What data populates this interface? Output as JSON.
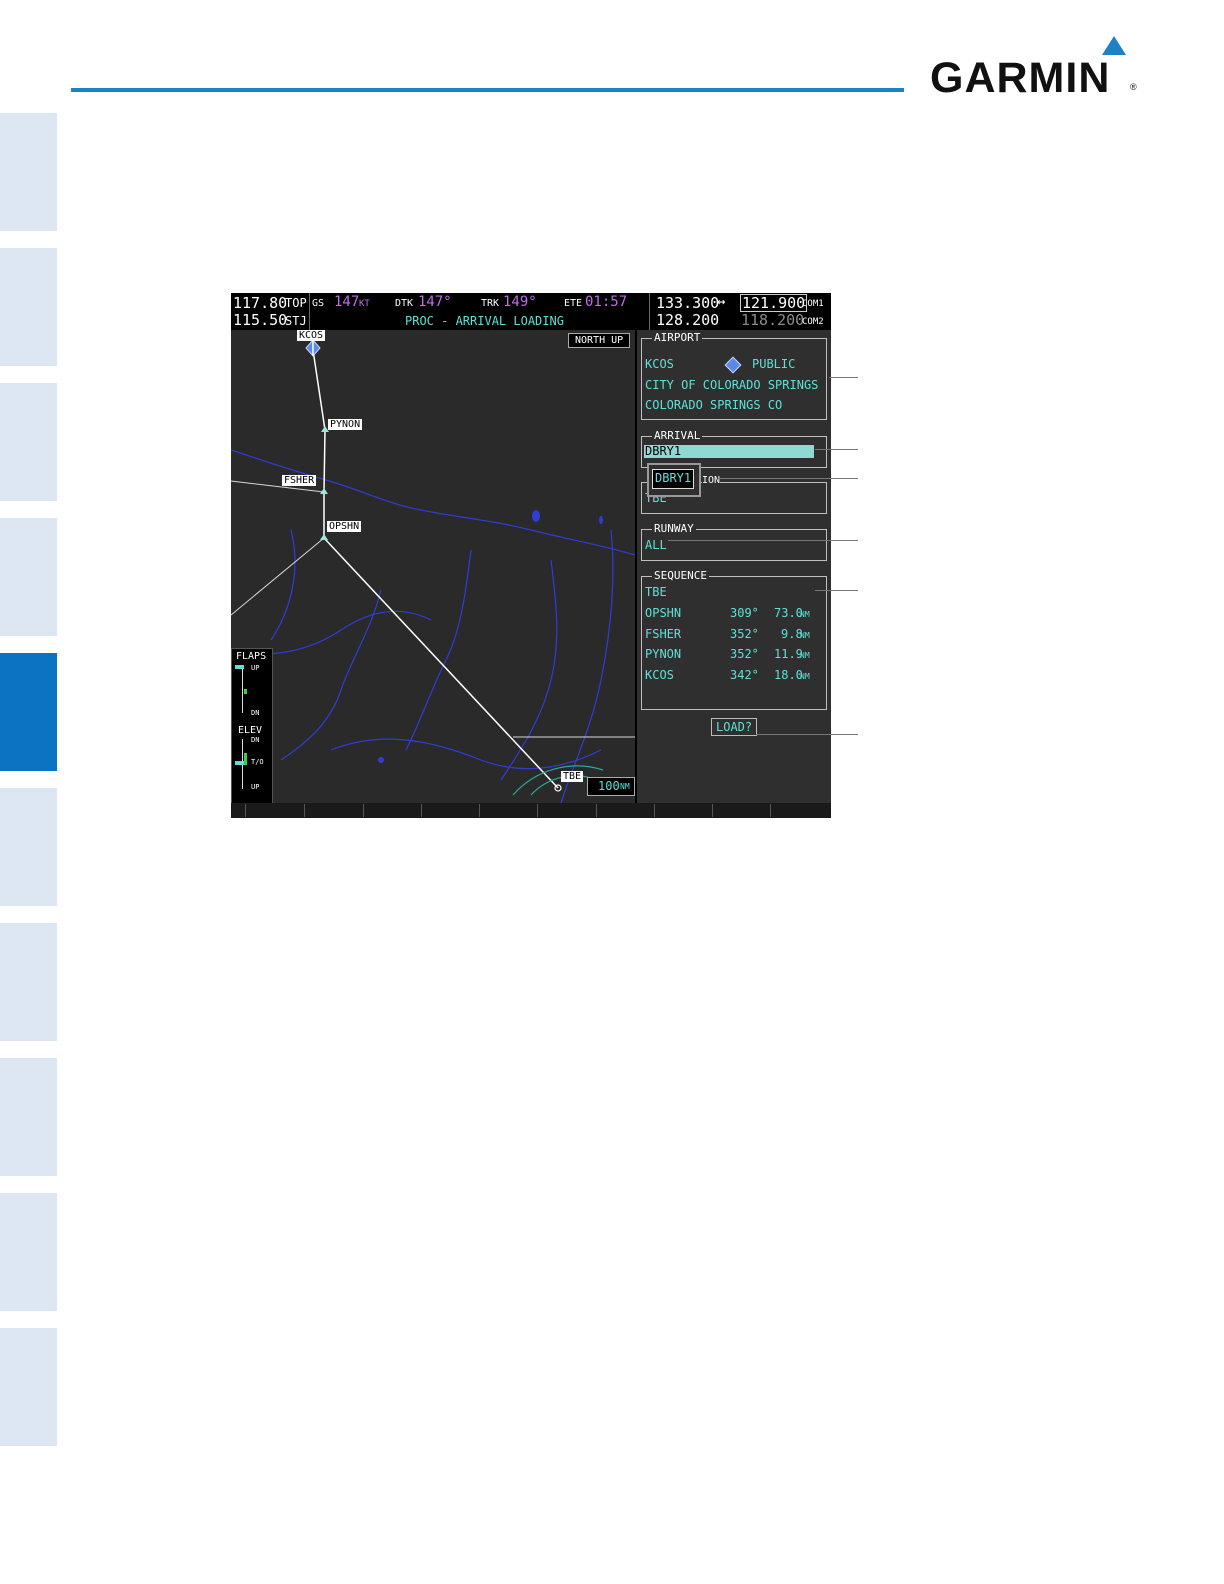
{
  "brand": {
    "name": "GARMIN",
    "reg": "®"
  },
  "top_bar": {
    "nav_freq_active": "117.80",
    "nav_freq_standby": "115.50",
    "nav_id_1": "TOP",
    "nav_id_2": "STJ",
    "gs_label": "GS",
    "gs_value": "147",
    "gs_unit": "KT",
    "dtk_label": "DTK",
    "dtk_value": "147°",
    "trk_label": "TRK",
    "trk_value": "149°",
    "ete_label": "ETE",
    "ete_value": "01:57",
    "page_title": "PROC - ARRIVAL LOADING",
    "com_standby_1": "133.300",
    "swap_arrow": "↔",
    "com_active_1": "121.900",
    "com1_label": "COM1",
    "com_standby_2": "128.200",
    "com_active_2": "118.200",
    "com2_label": "COM2"
  },
  "map": {
    "orientation": "NORTH UP",
    "range": "100",
    "range_unit": "NM",
    "waypoints": [
      "KCOS",
      "PYNON",
      "FSHER",
      "OPSHN",
      "TBE"
    ],
    "flaps": {
      "title": "FLAPS",
      "up": "UP",
      "dn": "DN"
    },
    "elev": {
      "title": "ELEV",
      "dn": "DN",
      "to": "T/O",
      "up": "UP"
    }
  },
  "airport": {
    "title": "AIRPORT",
    "id": "KCOS",
    "type": "PUBLIC",
    "name": "CITY OF COLORADO SPRINGS",
    "location": "COLORADO SPRINGS CO"
  },
  "arrival": {
    "title": "ARRIVAL",
    "selected": "DBRY1",
    "popup_value": "DBRY1"
  },
  "transition": {
    "title_fragment": "ION",
    "value": "TBE"
  },
  "runway": {
    "title": "RUNWAY",
    "value": "ALL"
  },
  "sequence": {
    "title": "SEQUENCE",
    "start": "TBE",
    "legs": [
      {
        "wpt": "OPSHN",
        "crs": "309°",
        "dist": "73.0",
        "unit": "NM"
      },
      {
        "wpt": "FSHER",
        "crs": "352°",
        "dist": "9.8",
        "unit": "NM"
      },
      {
        "wpt": "PYNON",
        "crs": "352°",
        "dist": "11.9",
        "unit": "NM"
      },
      {
        "wpt": "KCOS",
        "crs": "342°",
        "dist": "18.0",
        "unit": "NM"
      }
    ]
  },
  "load_button": "LOAD?",
  "colors": {
    "garmin_blue": "#1b82c8",
    "tab_active": "#0a74c2",
    "tab_inactive": "#dde7f4",
    "cyan_text": "#5fe0d7",
    "magenta_text": "#c36be8"
  }
}
